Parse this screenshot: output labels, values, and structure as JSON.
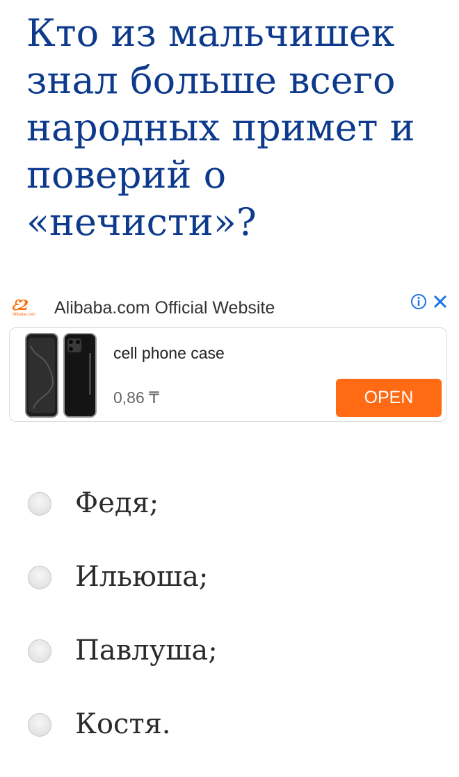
{
  "question": {
    "text": "Кто из мальчишек знал больше всего народных примет и поверий о «нечисти»?"
  },
  "ad": {
    "brand": "Alibaba.com",
    "title": "Alibaba.com Official Website",
    "info_icon": "info-icon",
    "close_icon": "close-icon",
    "product_name": "cell phone case",
    "price": "0,86 ₸",
    "open_label": "OPEN",
    "accent_color": "#ff6a13"
  },
  "options": [
    {
      "label": "Федя;"
    },
    {
      "label": "Ильюша;"
    },
    {
      "label": "Павлуша;"
    },
    {
      "label": "Костя."
    }
  ],
  "colors": {
    "question": "#0d3a8c",
    "option_text": "#2b2b2b",
    "ad_icons": "#1a73e8"
  }
}
